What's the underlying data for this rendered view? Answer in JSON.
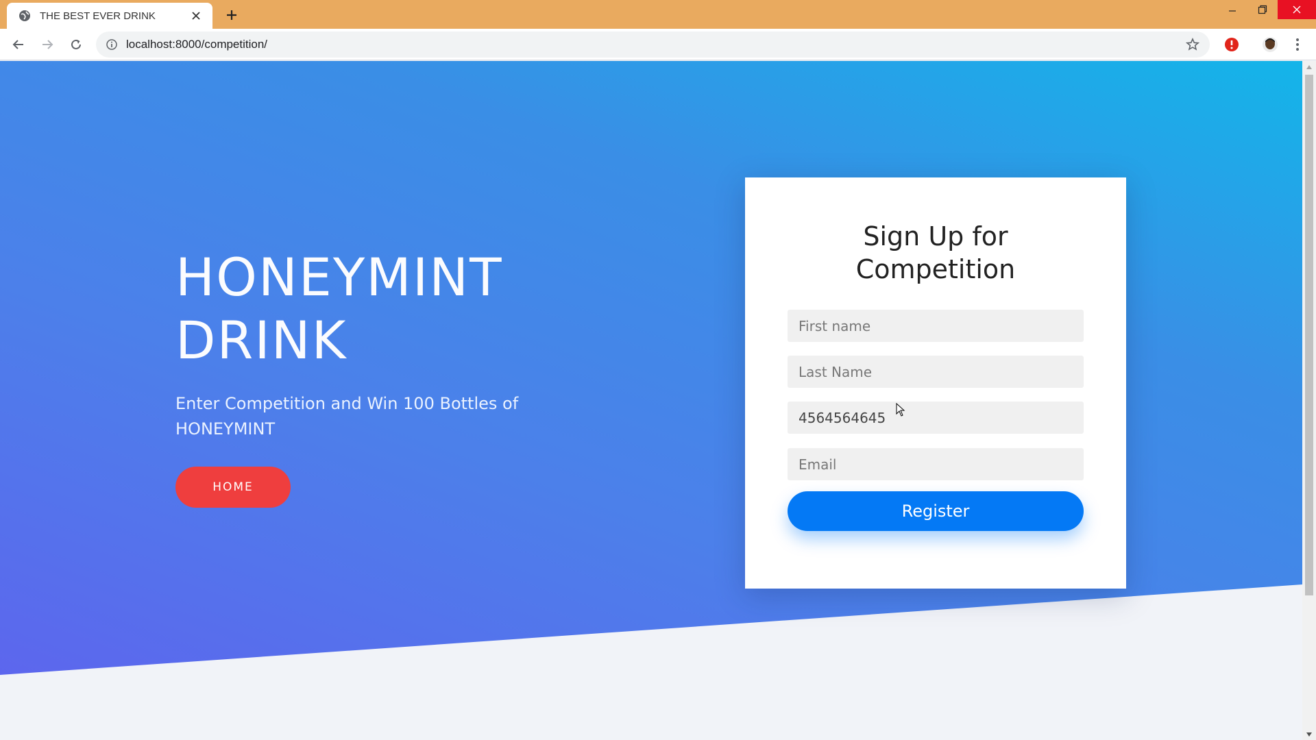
{
  "browser": {
    "tab_title": "THE BEST EVER DRINK",
    "url": "localhost:8000/competition/"
  },
  "hero": {
    "title_line1": "HONEYMINT",
    "title_line2": "DRINK",
    "subtitle": "Enter Competition and Win 100 Bottles of HONEYMINT",
    "home_button": "HOME"
  },
  "form": {
    "title_line1": "Sign Up for",
    "title_line2": "Competition",
    "first_name_placeholder": "First name",
    "last_name_placeholder": "Last Name",
    "phone_value": "4564564645",
    "email_placeholder": "Email",
    "register_button": "Register"
  },
  "colors": {
    "titlebar": "#e9aa5f",
    "hero_gradient_start": "#13b5e9",
    "hero_gradient_end": "#5f62ee",
    "home_button": "#ef3e3e",
    "register_button": "#0479f5"
  }
}
